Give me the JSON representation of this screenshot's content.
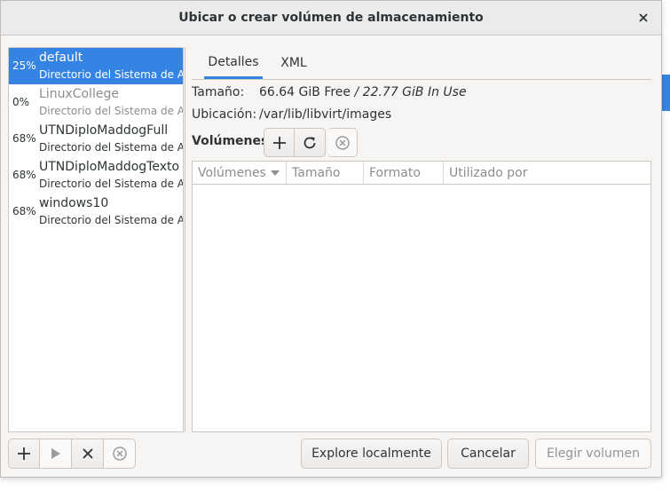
{
  "dialog": {
    "title": "Ubicar o crear volúmen de almacenamiento",
    "close_icon": "close-icon"
  },
  "pools": [
    {
      "percent": "25%",
      "name": "default",
      "type": "Directorio del Sistema de A…",
      "selected": true,
      "active": true
    },
    {
      "percent": "0%",
      "name": "LinuxCollege",
      "type": "Directorio del Sistema de A…",
      "selected": false,
      "active": false
    },
    {
      "percent": "68%",
      "name": "UTNDiploMaddogFull",
      "type": "Directorio del Sistema de A…",
      "selected": false,
      "active": true
    },
    {
      "percent": "68%",
      "name": "UTNDiploMaddogTexto",
      "type": "Directorio del Sistema de A…",
      "selected": false,
      "active": true
    },
    {
      "percent": "68%",
      "name": "windows10",
      "type": "Directorio del Sistema de A…",
      "selected": false,
      "active": true
    }
  ],
  "tabs": [
    {
      "label": "Detalles",
      "active": true
    },
    {
      "label": "XML",
      "active": false
    }
  ],
  "details": {
    "size_label": "Tamaño:",
    "size_free": "66.64 GiB Free",
    "size_sep": " / ",
    "size_used": "22.77 GiB In Use",
    "location_label": "Ubicación:",
    "location_value": "/var/lib/libvirt/images"
  },
  "volumes": {
    "label": "Volúmenes",
    "columns": [
      "Volúmenes",
      "Tamaño",
      "Formato",
      "Utilizado por"
    ],
    "sort_icon": "sort-descending-icon",
    "rows": []
  },
  "buttons": {
    "explore": "Explore localmente",
    "cancel": "Cancelar",
    "choose": "Elegir volumen"
  },
  "colors": {
    "accent": "#3584e4",
    "window_bg": "#f6f5f4",
    "text": "#2e3436",
    "muted": "#8b8e8f"
  }
}
